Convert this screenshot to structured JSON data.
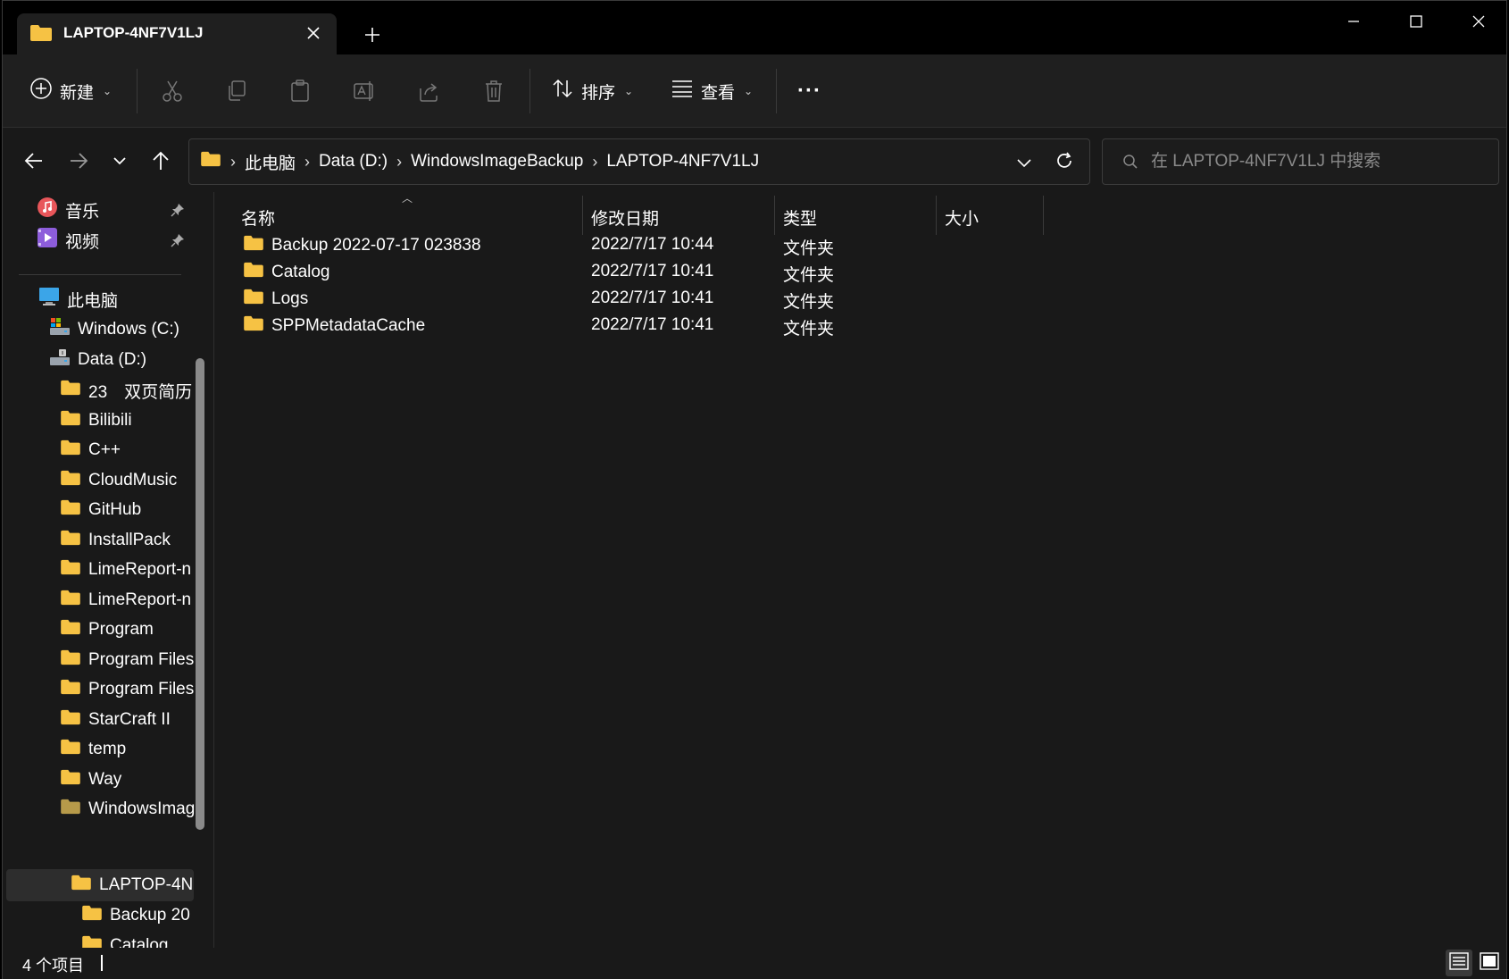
{
  "window": {
    "tab_title": "LAPTOP-4NF7V1LJ",
    "new_tab_label": "+"
  },
  "toolbar": {
    "new_label": "新建",
    "sort_label": "排序",
    "view_label": "查看",
    "more_label": "···"
  },
  "address": {
    "crumbs": [
      "此电脑",
      "Data (D:)",
      "WindowsImageBackup",
      "LAPTOP-4NF7V1LJ"
    ]
  },
  "search": {
    "placeholder": "在 LAPTOP-4NF7V1LJ 中搜索"
  },
  "sidebar": {
    "pinned": [
      {
        "label": "音乐",
        "icon": "music-icon"
      },
      {
        "label": "视频",
        "icon": "video-icon"
      }
    ],
    "this_pc": "此电脑",
    "drives": [
      {
        "label": "Windows (C:)",
        "icon": "drive-c-icon"
      },
      {
        "label": "Data (D:)",
        "icon": "drive-d-icon"
      }
    ],
    "folders": [
      "23　双页简历",
      "Bilibili",
      "C++",
      "CloudMusic",
      "GitHub",
      "InstallPack",
      "LimeReport-n",
      "LimeReport-n",
      "Program",
      "Program Files",
      "Program Files",
      "StarCraft II",
      "temp",
      "Way",
      "WindowsImag"
    ],
    "current": "LAPTOP-4N",
    "children": [
      "Backup 20",
      "Catalog"
    ]
  },
  "columns": {
    "name": "名称",
    "modified": "修改日期",
    "type": "类型",
    "size": "大小"
  },
  "files": [
    {
      "name": "Backup 2022-07-17 023838",
      "modified": "2022/7/17 10:44",
      "type": "文件夹"
    },
    {
      "name": "Catalog",
      "modified": "2022/7/17 10:41",
      "type": "文件夹"
    },
    {
      "name": "Logs",
      "modified": "2022/7/17 10:41",
      "type": "文件夹"
    },
    {
      "name": "SPPMetadataCache",
      "modified": "2022/7/17 10:41",
      "type": "文件夹"
    }
  ],
  "status": {
    "item_count": "4 个项目"
  },
  "colors": {
    "folder": "#f6c244",
    "background": "#191919",
    "titlebar": "#000000"
  }
}
